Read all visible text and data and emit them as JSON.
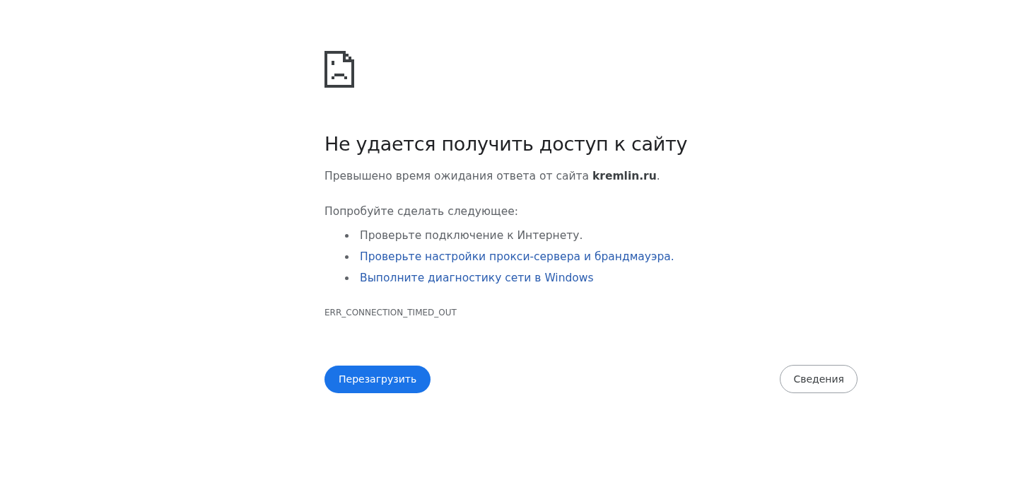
{
  "error": {
    "heading": "Не удается получить доступ к сайту",
    "message": "Превышено время ожидания ответа от сайта **kremlin.ru**.",
    "suggestions_intro": "Попробуйте сделать следующее:",
    "suggestions": [
      {
        "kind": "text",
        "text": "Проверьте подключение к Интернету."
      },
      {
        "kind": "link",
        "text": "Проверьте настройки прокси-сервера и брандмауэра."
      },
      {
        "kind": "link",
        "text": "Выполните диагностику сети в Windows"
      }
    ],
    "code": "ERR_CONNECTION_TIMED_OUT"
  },
  "buttons": [
    {
      "kind": "primary",
      "label": "Перезагрузить"
    },
    {
      "kind": "secondary",
      "label": "Сведения"
    }
  ]
}
